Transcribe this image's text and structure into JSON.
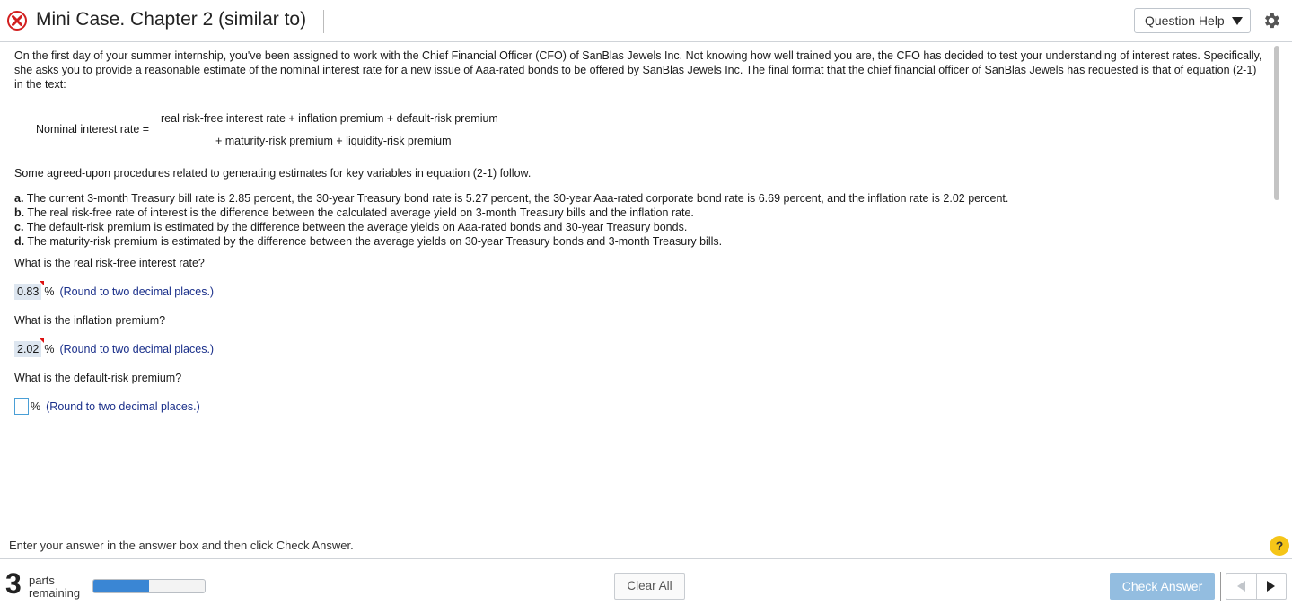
{
  "header": {
    "title": "Mini Case. Chapter 2 (similar to)",
    "status_icon": "incorrect-x-icon",
    "question_help_label": "Question Help",
    "settings_icon": "gear-icon"
  },
  "problem": {
    "intro": "On the first day of your summer internship, you've been assigned to work with the Chief Financial Officer (CFO) of SanBlas Jewels Inc. Not knowing how well trained you are, the CFO has decided to test your understanding of interest rates. Specifically, she asks you to provide a reasonable estimate of the nominal interest rate for a new issue of Aaa-rated bonds to be offered by SanBlas Jewels Inc. The final format that the chief financial officer of SanBlas Jewels has requested is that of equation (2-1) in the text:",
    "equation_label": "Nominal interest rate =",
    "equation_line1": "real risk-free interest rate + inflation premium + default-risk premium",
    "equation_line2": "+ maturity-risk premium + liquidity-risk premium",
    "follow": "Some agreed-upon procedures related to generating estimates for key variables in equation (2-1) follow.",
    "items": [
      {
        "letter": "a.",
        "text": "The current 3-month Treasury bill rate is 2.85 percent, the 30-year Treasury bond rate is 5.27 percent, the 30-year Aaa-rated corporate bond rate is 6.69 percent, and the inflation rate is 2.02 percent."
      },
      {
        "letter": "b.",
        "text": "The real risk-free rate of interest is the difference between the calculated average yield on 3-month Treasury bills and the inflation rate."
      },
      {
        "letter": "c.",
        "text": "The default-risk premium is estimated by the difference between the average yields on Aaa-rated bonds and 30-year Treasury bonds."
      },
      {
        "letter": "d.",
        "text": "The maturity-risk premium is estimated by the difference between the average yields on 30-year Treasury bonds and 3-month Treasury bills."
      }
    ]
  },
  "questions": [
    {
      "prompt": "What is the real risk-free interest rate?",
      "answer": "0.83",
      "unit": "%",
      "hint": "(Round to two decimal places.)"
    },
    {
      "prompt": "What is the inflation premium?",
      "answer": "2.02",
      "unit": "%",
      "hint": "(Round to two decimal places.)"
    },
    {
      "prompt": "What is the default-risk premium?",
      "answer": "",
      "unit": "%",
      "hint": "(Round to two decimal places.)"
    }
  ],
  "footer": {
    "instruction": "Enter your answer in the answer box and then click Check Answer.",
    "help_symbol": "?",
    "parts_count": "3",
    "parts_line1": "parts",
    "parts_line2": "remaining",
    "progress_fraction": 0.5,
    "clear_all_label": "Clear All",
    "check_answer_label": "Check Answer"
  }
}
